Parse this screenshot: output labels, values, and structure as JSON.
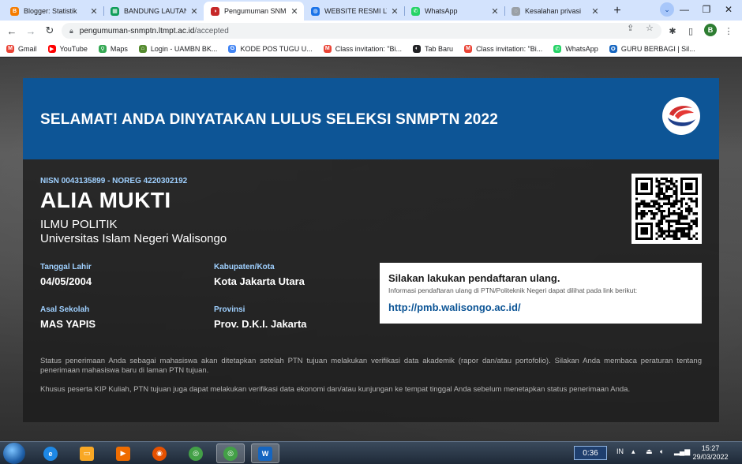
{
  "browser": {
    "tabs": [
      {
        "title": "Blogger: Statistik",
        "icon": "blogger-icon",
        "color": "#f57c00",
        "glyph": "B"
      },
      {
        "title": "BANDUNG LAUTAN",
        "icon": "sheets-icon",
        "color": "#0f9d58",
        "glyph": "▦"
      },
      {
        "title": "Pengumuman SNMP",
        "icon": "snmptn-icon",
        "color": "#c62828",
        "glyph": "◑",
        "active": true
      },
      {
        "title": "WEBSITE RESMI LTM",
        "icon": "globe-icon",
        "color": "#1a73e8",
        "glyph": "◍"
      },
      {
        "title": "WhatsApp",
        "icon": "whatsapp-icon",
        "color": "#25d366",
        "glyph": "✆"
      },
      {
        "title": "Kesalahan privasi",
        "icon": "warning-globe-icon",
        "color": "#9aa0a6",
        "glyph": "◌"
      }
    ],
    "url_domain": "pengumuman-snmptn.ltmpt.ac.id",
    "url_path": "/accepted",
    "profile_initial": "B",
    "bookmarks": [
      {
        "label": "Gmail",
        "icon": "gmail-icon",
        "color": "#ea4335",
        "glyph": "M"
      },
      {
        "label": "YouTube",
        "icon": "youtube-icon",
        "color": "#ff0000",
        "glyph": "▶"
      },
      {
        "label": "Maps",
        "icon": "maps-icon",
        "color": "#34a853",
        "glyph": "⚲"
      },
      {
        "label": "Login - UAMBN BK...",
        "icon": "uambn-icon",
        "color": "#558b2f",
        "glyph": "⌂"
      },
      {
        "label": "KODE POS TUGU U...",
        "icon": "google-icon",
        "color": "#4285f4",
        "glyph": "G"
      },
      {
        "label": "Class invitation: \"Bi...",
        "icon": "gmail-icon",
        "color": "#ea4335",
        "glyph": "M"
      },
      {
        "label": "Tab Baru",
        "icon": "tab-icon",
        "color": "#202124",
        "glyph": "◐"
      },
      {
        "label": "Class invitation: \"Bi...",
        "icon": "gmail-icon",
        "color": "#ea4335",
        "glyph": "M"
      },
      {
        "label": "WhatsApp",
        "icon": "whatsapp-icon",
        "color": "#25d366",
        "glyph": "✆"
      },
      {
        "label": "GURU BERBAGI | Sil...",
        "icon": "guru-berbagi-icon",
        "color": "#1565c0",
        "glyph": "✪"
      }
    ]
  },
  "banner": {
    "title": "SELAMAT! ANDA DINYATAKAN LULUS SELEKSI SNMPTN 2022"
  },
  "student": {
    "nisn_noreg": "NISN 0043135899 - NOREG 4220302192",
    "name": "ALIA MUKTI",
    "program": "ILMU POLITIK",
    "university": "Universitas Islam Negeri Walisongo"
  },
  "details": {
    "birth_label": "Tanggal Lahir",
    "birth_value": "04/05/2004",
    "city_label": "Kabupaten/Kota",
    "city_value": "Kota Jakarta Utara",
    "school_label": "Asal Sekolah",
    "school_value": "MAS YAPIS",
    "province_label": "Provinsi",
    "province_value": "Prov. D.K.I. Jakarta"
  },
  "registration": {
    "heading": "Silakan lakukan pendaftaran ulang.",
    "subtext": "Informasi pendaftaran ulang di PTN/Politeknik Negeri dapat dilihat pada link berikut:",
    "link": "http://pmb.walisongo.ac.id/"
  },
  "notes": {
    "status": "Status penerimaan Anda sebagai mahasiswa akan ditetapkan setelah PTN tujuan melakukan verifikasi data akademik (rapor dan/atau portofolio). Silakan Anda membaca peraturan tentang penerimaan mahasiswa baru di laman PTN tujuan.",
    "kip": "Khusus peserta KIP Kuliah, PTN tujuan juga dapat melakukan verifikasi data ekonomi dan/atau kunjungan ke tempat tinggal Anda sebelum menetapkan status penerimaan Anda."
  },
  "taskbar": {
    "apps": [
      {
        "icon": "internet-explorer-icon",
        "color": "#1e88e5",
        "glyph": "e"
      },
      {
        "icon": "file-explorer-icon",
        "color": "#f9a825",
        "glyph": "▭"
      },
      {
        "icon": "media-player-icon",
        "color": "#ef6c00",
        "glyph": "▶"
      },
      {
        "icon": "firefox-icon",
        "color": "#e65100",
        "glyph": "◉"
      },
      {
        "icon": "chrome-icon",
        "color": "#43a047",
        "glyph": "◎"
      },
      {
        "icon": "chrome-profile-icon",
        "color": "#43a047",
        "glyph": "◎",
        "active": true
      },
      {
        "icon": "word-icon",
        "color": "#1565c0",
        "glyph": "W",
        "active": true
      }
    ],
    "timer": "0:36",
    "lang": "IN",
    "time": "15:27",
    "date": "29/03/2022"
  },
  "colors": {
    "banner_blue": "#0d5596",
    "label_blue": "#9fd0ff",
    "link_blue": "#0d5596"
  }
}
